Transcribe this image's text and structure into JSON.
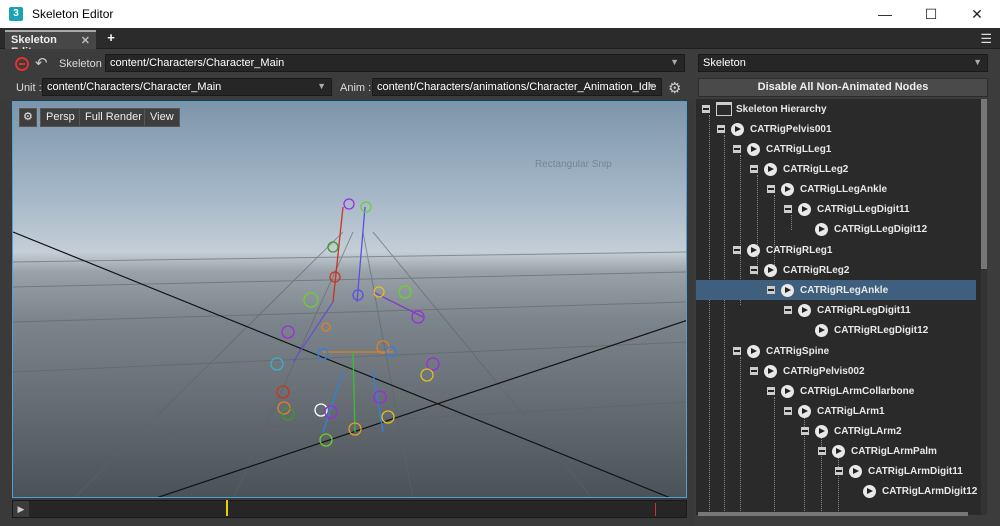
{
  "window": {
    "title": "Skeleton Editor",
    "icon": "3"
  },
  "tab": {
    "label": "Skeleton Editor",
    "close": "✕",
    "add": "+"
  },
  "toolbar": {
    "skeleton_label": "Skeleton :",
    "skeleton_value": "content/Characters/Character_Main",
    "unit_label": "Unit :",
    "unit_value": "content/Characters/Character_Main",
    "anim_label": "Anim :",
    "anim_value": "content/Characters/animations/Character_Animation_Idle"
  },
  "viewport": {
    "buttons": [
      "Persp",
      "Full Render",
      "View"
    ],
    "overlay_text": "Rectangular Snip"
  },
  "right_panel": {
    "dropdown": "Skeleton",
    "disable_button": "Disable All Non-Animated Nodes",
    "root": "Skeleton Hierarchy",
    "nodes": [
      {
        "label": "CATRigPelvis001"
      },
      {
        "label": "CATRigLLeg1"
      },
      {
        "label": "CATRigLLeg2"
      },
      {
        "label": "CATRigLLegAnkle"
      },
      {
        "label": "CATRigLLegDigit11"
      },
      {
        "label": "CATRigLLegDigit12"
      },
      {
        "label": "CATRigRLeg1"
      },
      {
        "label": "CATRigRLeg2"
      },
      {
        "label": "CATRigRLegAnkle"
      },
      {
        "label": "CATRigRLegDigit11"
      },
      {
        "label": "CATRigRLegDigit12"
      },
      {
        "label": "CATRigSpine"
      },
      {
        "label": "CATRigPelvis002"
      },
      {
        "label": "CATRigLArmCollarbone"
      },
      {
        "label": "CATRigLArm1"
      },
      {
        "label": "CATRigLArm2"
      },
      {
        "label": "CATRigLArmPalm"
      },
      {
        "label": "CATRigLArmDigit11"
      },
      {
        "label": "CATRigLArmDigit12"
      }
    ]
  },
  "colors": {
    "selection": "#3f5f7f",
    "viewport_border": "#4aa3d6"
  }
}
